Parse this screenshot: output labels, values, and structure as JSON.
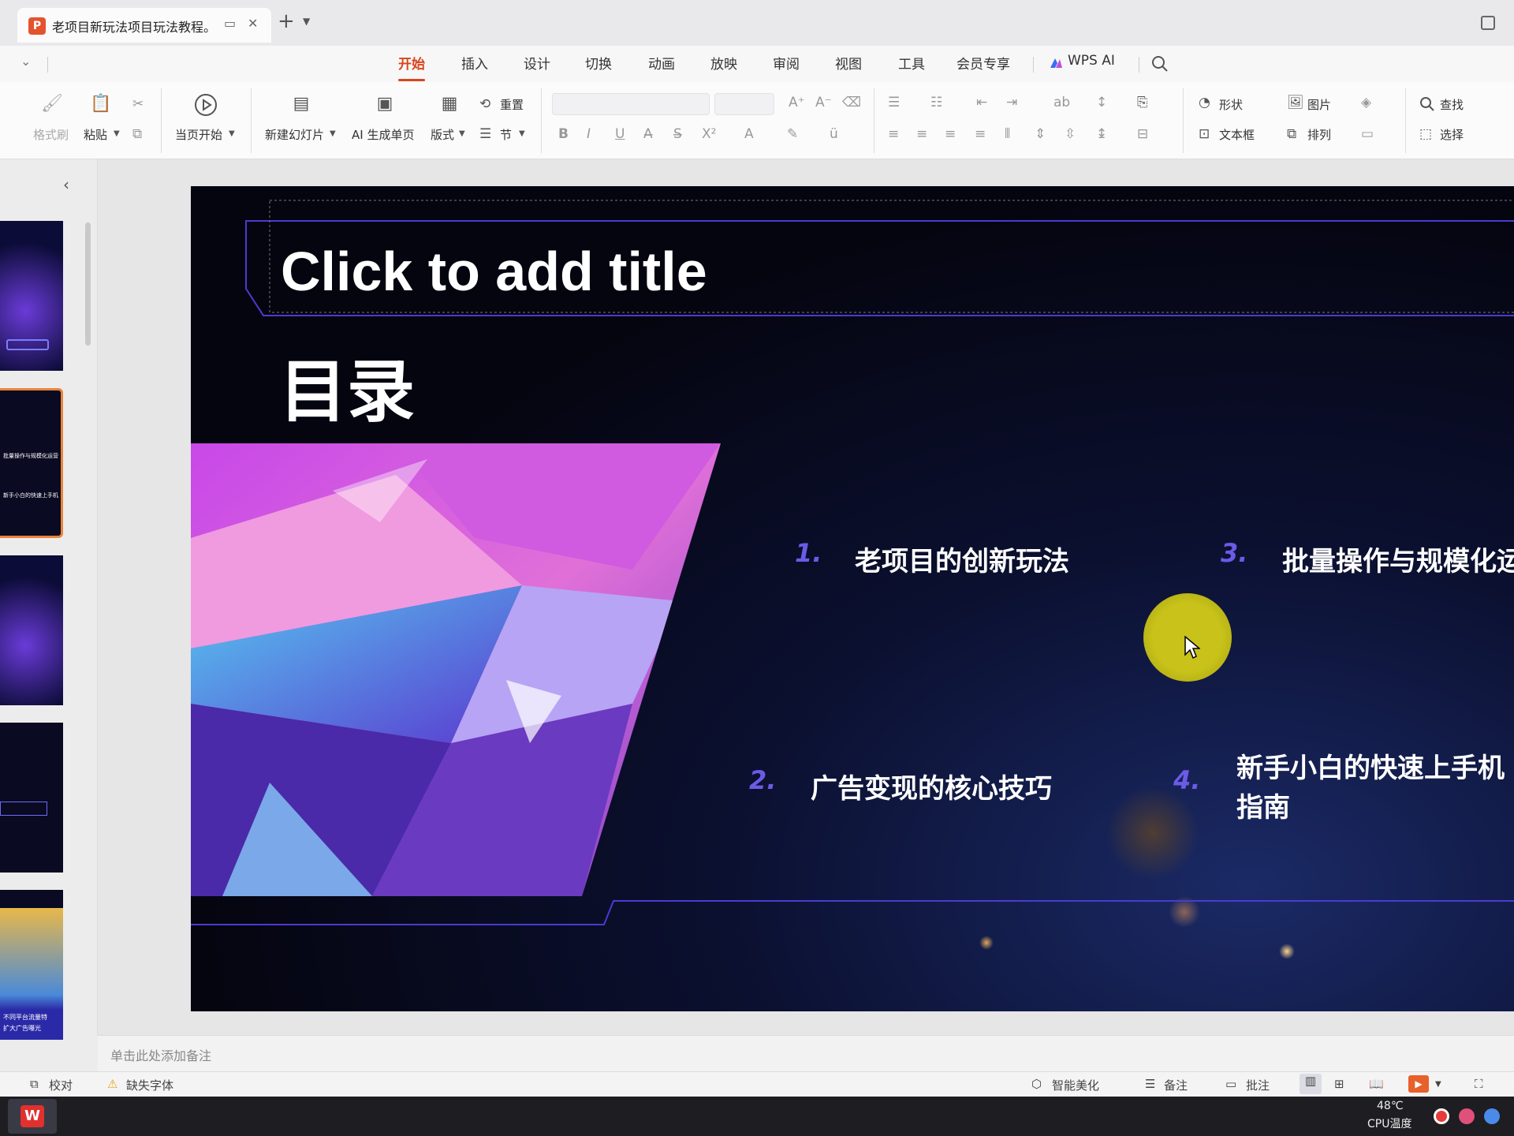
{
  "window": {
    "doc_tab_title": "老项目新玩法项目玩法教程。",
    "new_tab": "+",
    "tab_dropdown": "⌄"
  },
  "menu": {
    "items": [
      "开始",
      "插入",
      "设计",
      "切换",
      "动画",
      "放映",
      "审阅",
      "视图",
      "工具",
      "会员专享",
      "WPS AI"
    ],
    "active": "开始"
  },
  "ribbon": {
    "format_painter": "格式刷",
    "paste": "粘贴",
    "start_from_current": "当页开始",
    "new_slide": "新建幻灯片",
    "ai_page": "AI 生成单页",
    "layout": "版式",
    "reset": "重置",
    "section": "节",
    "shape": "形状",
    "picture": "图片",
    "find": "查找",
    "textbox": "文本框",
    "arrange": "排列",
    "select": "选择"
  },
  "slide": {
    "title_placeholder": "Click to add title",
    "heading": "目录",
    "items": [
      {
        "num": "1.",
        "text": "老项目的创新玩法"
      },
      {
        "num": "2.",
        "text": "广告变现的核心技巧"
      },
      {
        "num": "3.",
        "text": "批量操作与规模化运"
      },
      {
        "num": "4.",
        "text_line1": "新手小白的快速上手机",
        "text_line2": "指南"
      }
    ]
  },
  "thumbs": {
    "t2_line1": "批量操作与规模化运营",
    "t2_line2": "新手小白的快速上手机",
    "t5_line1": "不同平台流量特",
    "t5_line2": "扩大广告曝光"
  },
  "notes": {
    "placeholder": "单击此处添加备注"
  },
  "status": {
    "proofread": "校对",
    "missing_font": "缺失字体",
    "smart_beautify": "智能美化",
    "notes": "备注",
    "comments": "批注"
  },
  "taskbar": {
    "temp": "48℃",
    "cpu_label": "CPU温度"
  },
  "colors": {
    "accent": "#d9451e",
    "slide_number": "#6b5be6",
    "cursor_highlight": "#c8c21a"
  }
}
